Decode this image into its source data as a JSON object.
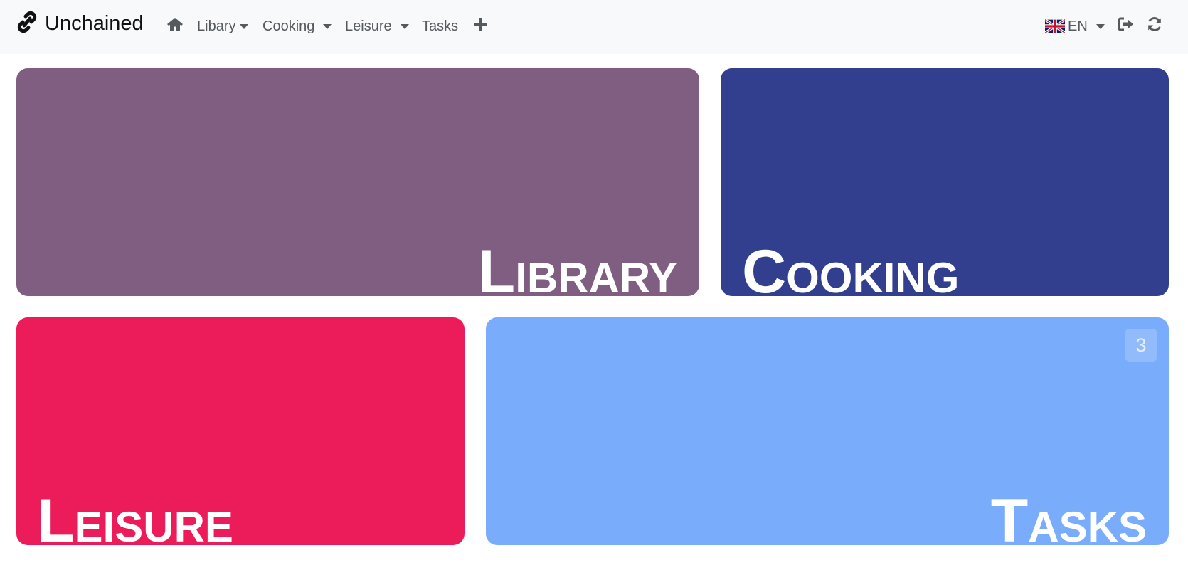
{
  "navbar": {
    "brand": "Unchained",
    "brand_icon": "link-icon",
    "items": [
      {
        "label": "Libary",
        "dropdown": true
      },
      {
        "label": "Cooking",
        "dropdown": true
      },
      {
        "label": "Leisure",
        "dropdown": true
      },
      {
        "label": "Tasks",
        "dropdown": false
      }
    ],
    "language": "EN",
    "language_flag": "uk-flag-icon",
    "icons": [
      "home-icon",
      "plus-icon",
      "sign-out-icon",
      "refresh-icon"
    ]
  },
  "tiles": [
    {
      "title": "Library",
      "color": "#7f5e82"
    },
    {
      "title": "Cooking",
      "color": "#323f8f"
    },
    {
      "title": "Leisure",
      "color": "#ec1c5b"
    },
    {
      "title": "Tasks",
      "color": "#7aacfc",
      "badge": "3"
    }
  ]
}
